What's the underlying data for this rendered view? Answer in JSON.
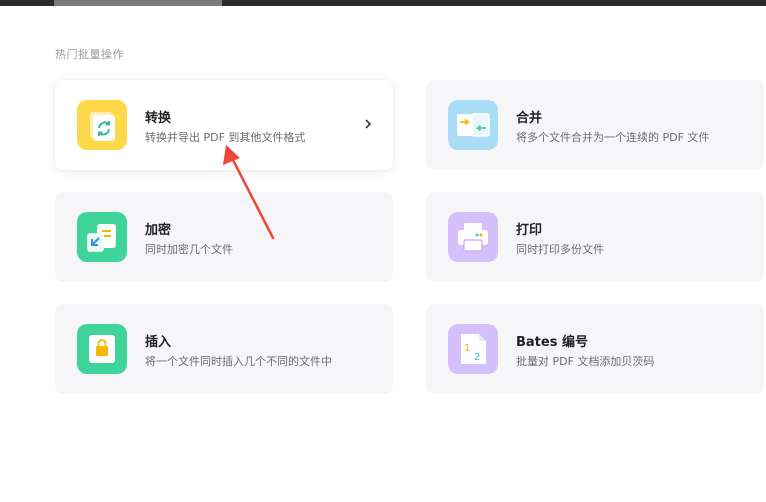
{
  "section": {
    "title": "热门批量操作"
  },
  "cards": [
    {
      "title": "转换",
      "desc": "转换并导出 PDF 到其他文件格式",
      "icon": "convert-icon",
      "color": "#ffd84a"
    },
    {
      "title": "合并",
      "desc": "将多个文件合并为一个连续的 PDF 文件",
      "icon": "merge-icon",
      "color": "#a9dcf5"
    },
    {
      "title": "加密",
      "desc": "同时加密几个文件",
      "icon": "encrypt-icon",
      "color": "#3fd49a"
    },
    {
      "title": "打印",
      "desc": "同时打印多份文件",
      "icon": "printer-icon",
      "color": "#d6c0fb"
    },
    {
      "title": "插入",
      "desc": "将一个文件同时插入几个不同的文件中",
      "icon": "insert-icon",
      "color": "#3fd49a"
    },
    {
      "title": "Bates 编号",
      "desc": "批量对 PDF 文档添加贝茨码",
      "icon": "bates-number-icon",
      "color": "#d6c0fb"
    }
  ],
  "annotation": {
    "color": "#f0453a"
  }
}
